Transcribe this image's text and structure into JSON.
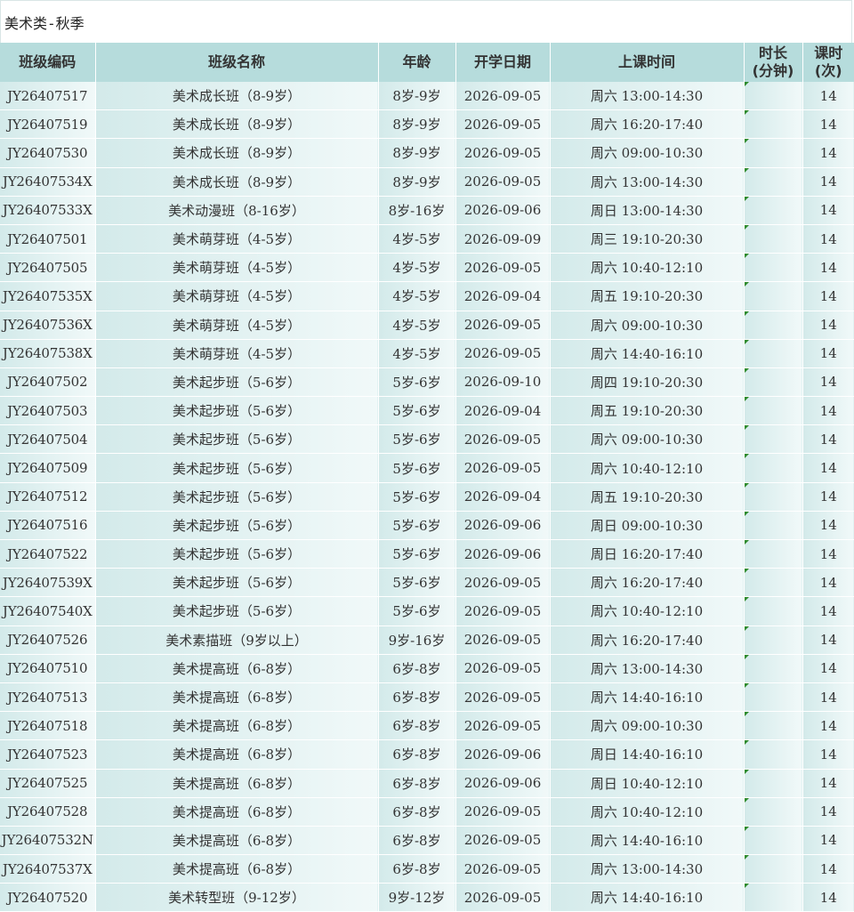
{
  "title": "美术类-秋季",
  "columns": [
    "班级编码",
    "班级名称",
    "年龄",
    "开学日期",
    "上课时间",
    "时长\n(分钟)",
    "课时\n(次)"
  ],
  "rows": [
    {
      "code": "JY26407517",
      "name": "美术成长班（8-9岁）",
      "age": "8岁-9岁",
      "start": "2026-09-05",
      "time": "周六 13:00-14:30",
      "duration": "",
      "lessons": "14"
    },
    {
      "code": "JY26407519",
      "name": "美术成长班（8-9岁）",
      "age": "8岁-9岁",
      "start": "2026-09-05",
      "time": "周六 16:20-17:40",
      "duration": "",
      "lessons": "14"
    },
    {
      "code": "JY26407530",
      "name": "美术成长班（8-9岁）",
      "age": "8岁-9岁",
      "start": "2026-09-05",
      "time": "周六 09:00-10:30",
      "duration": "",
      "lessons": "14"
    },
    {
      "code": "JY26407534X",
      "name": "美术成长班（8-9岁）",
      "age": "8岁-9岁",
      "start": "2026-09-05",
      "time": "周六 13:00-14:30",
      "duration": "",
      "lessons": "14"
    },
    {
      "code": "JY26407533X",
      "name": "美术动漫班（8-16岁）",
      "age": "8岁-16岁",
      "start": "2026-09-06",
      "time": "周日 13:00-14:30",
      "duration": "",
      "lessons": "14"
    },
    {
      "code": "JY26407501",
      "name": "美术萌芽班（4-5岁）",
      "age": "4岁-5岁",
      "start": "2026-09-09",
      "time": "周三 19:10-20:30",
      "duration": "",
      "lessons": "14"
    },
    {
      "code": "JY26407505",
      "name": "美术萌芽班（4-5岁）",
      "age": "4岁-5岁",
      "start": "2026-09-05",
      "time": "周六 10:40-12:10",
      "duration": "",
      "lessons": "14"
    },
    {
      "code": "JY26407535X",
      "name": "美术萌芽班（4-5岁）",
      "age": "4岁-5岁",
      "start": "2026-09-04",
      "time": "周五 19:10-20:30",
      "duration": "",
      "lessons": "14"
    },
    {
      "code": "JY26407536X",
      "name": "美术萌芽班（4-5岁）",
      "age": "4岁-5岁",
      "start": "2026-09-05",
      "time": "周六 09:00-10:30",
      "duration": "",
      "lessons": "14"
    },
    {
      "code": "JY26407538X",
      "name": "美术萌芽班（4-5岁）",
      "age": "4岁-5岁",
      "start": "2026-09-05",
      "time": "周六 14:40-16:10",
      "duration": "",
      "lessons": "14"
    },
    {
      "code": "JY26407502",
      "name": "美术起步班（5-6岁）",
      "age": "5岁-6岁",
      "start": "2026-09-10",
      "time": "周四 19:10-20:30",
      "duration": "",
      "lessons": "14"
    },
    {
      "code": "JY26407503",
      "name": "美术起步班（5-6岁）",
      "age": "5岁-6岁",
      "start": "2026-09-04",
      "time": "周五 19:10-20:30",
      "duration": "",
      "lessons": "14"
    },
    {
      "code": "JY26407504",
      "name": "美术起步班（5-6岁）",
      "age": "5岁-6岁",
      "start": "2026-09-05",
      "time": "周六 09:00-10:30",
      "duration": "",
      "lessons": "14"
    },
    {
      "code": "JY26407509",
      "name": "美术起步班（5-6岁）",
      "age": "5岁-6岁",
      "start": "2026-09-05",
      "time": "周六 10:40-12:10",
      "duration": "",
      "lessons": "14"
    },
    {
      "code": "JY26407512",
      "name": "美术起步班（5-6岁）",
      "age": "5岁-6岁",
      "start": "2026-09-04",
      "time": "周五 19:10-20:30",
      "duration": "",
      "lessons": "14"
    },
    {
      "code": "JY26407516",
      "name": "美术起步班（5-6岁）",
      "age": "5岁-6岁",
      "start": "2026-09-06",
      "time": "周日 09:00-10:30",
      "duration": "",
      "lessons": "14"
    },
    {
      "code": "JY26407522",
      "name": "美术起步班（5-6岁）",
      "age": "5岁-6岁",
      "start": "2026-09-06",
      "time": "周日 16:20-17:40",
      "duration": "",
      "lessons": "14"
    },
    {
      "code": "JY26407539X",
      "name": "美术起步班（5-6岁）",
      "age": "5岁-6岁",
      "start": "2026-09-05",
      "time": "周六 16:20-17:40",
      "duration": "",
      "lessons": "14"
    },
    {
      "code": "JY26407540X",
      "name": "美术起步班（5-6岁）",
      "age": "5岁-6岁",
      "start": "2026-09-05",
      "time": "周六 10:40-12:10",
      "duration": "",
      "lessons": "14"
    },
    {
      "code": "JY26407526",
      "name": "美术素描班（9岁以上）",
      "age": "9岁-16岁",
      "start": "2026-09-05",
      "time": "周六 16:20-17:40",
      "duration": "",
      "lessons": "14"
    },
    {
      "code": "JY26407510",
      "name": "美术提高班（6-8岁）",
      "age": "6岁-8岁",
      "start": "2026-09-05",
      "time": "周六 13:00-14:30",
      "duration": "",
      "lessons": "14"
    },
    {
      "code": "JY26407513",
      "name": "美术提高班（6-8岁）",
      "age": "6岁-8岁",
      "start": "2026-09-05",
      "time": "周六 14:40-16:10",
      "duration": "",
      "lessons": "14"
    },
    {
      "code": "JY26407518",
      "name": "美术提高班（6-8岁）",
      "age": "6岁-8岁",
      "start": "2026-09-05",
      "time": "周六 09:00-10:30",
      "duration": "",
      "lessons": "14"
    },
    {
      "code": "JY26407523",
      "name": "美术提高班（6-8岁）",
      "age": "6岁-8岁",
      "start": "2026-09-06",
      "time": "周日 14:40-16:10",
      "duration": "",
      "lessons": "14"
    },
    {
      "code": "JY26407525",
      "name": "美术提高班（6-8岁）",
      "age": "6岁-8岁",
      "start": "2026-09-06",
      "time": "周日 10:40-12:10",
      "duration": "",
      "lessons": "14"
    },
    {
      "code": "JY26407528",
      "name": "美术提高班（6-8岁）",
      "age": "6岁-8岁",
      "start": "2026-09-05",
      "time": "周六 10:40-12:10",
      "duration": "",
      "lessons": "14"
    },
    {
      "code": "JY26407532N",
      "name": "美术提高班（6-8岁）",
      "age": "6岁-8岁",
      "start": "2026-09-05",
      "time": "周六 14:40-16:10",
      "duration": "",
      "lessons": "14"
    },
    {
      "code": "JY26407537X",
      "name": "美术提高班（6-8岁）",
      "age": "6岁-8岁",
      "start": "2026-09-05",
      "time": "周六 13:00-14:30",
      "duration": "",
      "lessons": "14"
    },
    {
      "code": "JY26407520",
      "name": "美术转型班（9-12岁）",
      "age": "9岁-12岁",
      "start": "2026-09-05",
      "time": "周六 14:40-16:10",
      "duration": "",
      "lessons": "14"
    }
  ],
  "colors": {
    "header_bg": "#b6dcdc",
    "row_bg_left": "#d3eaea",
    "row_bg_right": "#f1f9f9",
    "indicator": "#2e8b2e"
  }
}
